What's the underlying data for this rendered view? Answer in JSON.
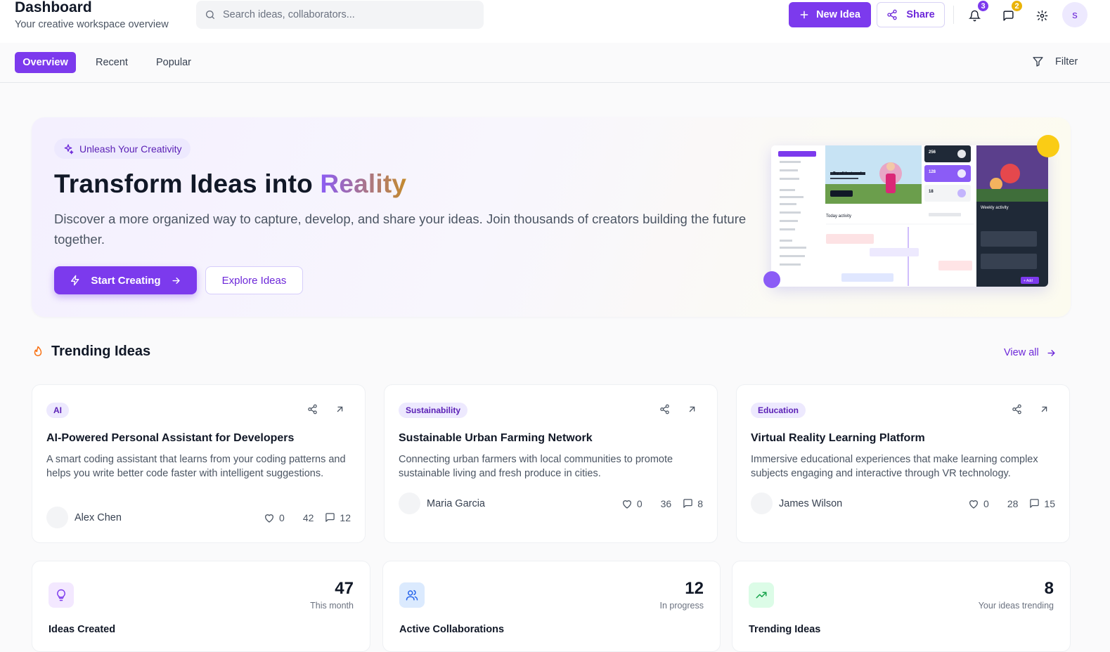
{
  "header": {
    "title": "Dashboard",
    "subtitle": "Your creative workspace overview",
    "search_placeholder": "Search ideas, collaborators...",
    "new_idea_label": "New Idea",
    "share_label": "Share",
    "notifications_count": "3",
    "messages_count": "2",
    "avatar_initial": "s"
  },
  "tabs": {
    "items": [
      {
        "label": "Overview",
        "active": true
      },
      {
        "label": "Recent",
        "active": false
      },
      {
        "label": "Popular",
        "active": false
      }
    ],
    "filter_label": "Filter"
  },
  "hero": {
    "pill": "Unleash Your Creativity",
    "title_main": "Transform Ideas into ",
    "title_highlight": "Reality",
    "description": "Discover a more organized way to capture, develop, and share your ideas. Join thousands of creators building the future together.",
    "start_label": "Start Creating",
    "explore_label": "Explore Ideas"
  },
  "trending": {
    "title": "Trending Ideas",
    "view_all": "View all",
    "cards": [
      {
        "tag": "AI",
        "title": "AI-Powered Personal Assistant for Developers",
        "description": "A smart coding assistant that learns from your coding patterns and helps you write better code faster with intelligent suggestions.",
        "author": "Alex Chen",
        "likes": "0",
        "views": "42",
        "comments": "12"
      },
      {
        "tag": "Sustainability",
        "title": "Sustainable Urban Farming Network",
        "description": "Connecting urban farmers with local communities to promote sustainable living and fresh produce in cities.",
        "author": "Maria Garcia",
        "likes": "0",
        "views": "36",
        "comments": "8"
      },
      {
        "tag": "Education",
        "title": "Virtual Reality Learning Platform",
        "description": "Immersive educational experiences that make learning complex subjects engaging and interactive through VR technology.",
        "author": "James Wilson",
        "likes": "0",
        "views": "28",
        "comments": "15"
      }
    ]
  },
  "stats": [
    {
      "value": "47",
      "caption": "This month",
      "label": "Ideas Created",
      "icon": "lightbulb-icon",
      "color": "#7c3aed"
    },
    {
      "value": "12",
      "caption": "In progress",
      "label": "Active Collaborations",
      "icon": "users-icon",
      "color": "#2563eb"
    },
    {
      "value": "8",
      "caption": "Your ideas trending",
      "label": "Trending Ideas",
      "icon": "trending-up-icon",
      "color": "#16a34a"
    }
  ],
  "colors": {
    "accent": "#7c3aed",
    "notif_badge": "#7c3aed",
    "message_badge": "#eab308"
  },
  "mockup": {
    "stat_a": "256",
    "stat_b": "128",
    "stat_c": "18",
    "card_heading": "Try all features!",
    "cta": "Upgrade plan",
    "activity_title": "Today activity",
    "weekly_title": "Weekly activity",
    "add_label": "+ Add"
  }
}
